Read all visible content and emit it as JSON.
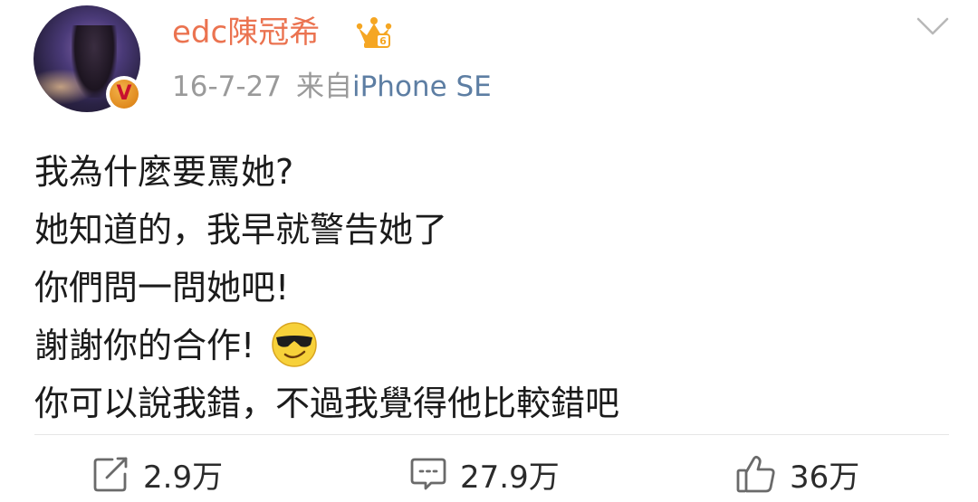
{
  "post": {
    "username": "edc陳冠希",
    "date": "16-7-27",
    "source_prefix": "来自",
    "device": "iPhone SE",
    "badge_letter": "V",
    "lines": [
      "我為什麼要罵她?",
      "她知道的，我早就警告她了",
      "你們問一問她吧!",
      "謝謝你的合作!",
      "你可以說我錯，不過我覺得他比較錯吧"
    ]
  },
  "actions": {
    "repost_count": "2.9万",
    "comment_count": "27.9万",
    "like_count": "36万"
  },
  "icons": {
    "menu": "chevron-down-icon",
    "vip": "crown-icon",
    "emoji": "sunglasses-emoji-icon",
    "repost": "repost-icon",
    "comment": "comment-icon",
    "like": "thumbs-up-icon"
  },
  "colors": {
    "username": "#eb7350",
    "device": "#5d7ea3",
    "meta": "#9a9a9a"
  }
}
